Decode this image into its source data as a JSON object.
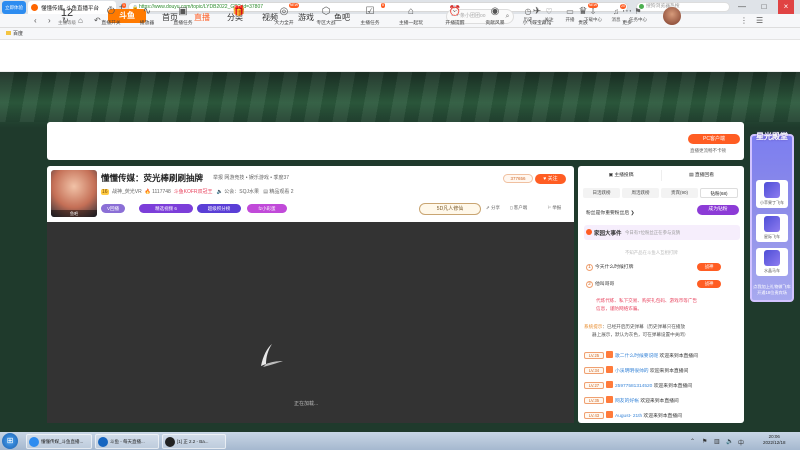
{
  "browser": {
    "logo_label": "立即体验",
    "tab_title": "懂懂传媒_斗鱼直播平台",
    "tab_close": "×",
    "new_tab": "+",
    "url": "https://www.douyu.com/topic/LYDB2022_GD?rid=37807",
    "search_placeholder": "搜狗浏览器热搜",
    "bookmark": "百度",
    "win_min": "—",
    "win_max": "□",
    "win_close": "×"
  },
  "header": {
    "logo": "斗鱼",
    "nav": [
      "首页",
      "直播",
      "分类",
      "视频",
      "游戏",
      "鱼吧"
    ],
    "search_placeholder": "一条小团团oo",
    "icons": [
      {
        "label": "历史",
        "icon": "history-icon",
        "glyph": "◷"
      },
      {
        "label": "关注",
        "icon": "heart-icon",
        "glyph": "♡"
      },
      {
        "label": "开播",
        "icon": "camera-icon",
        "glyph": "▭"
      },
      {
        "label": "下载中心",
        "icon": "download-icon",
        "glyph": "⇩"
      },
      {
        "label": "消息",
        "icon": "bell-icon",
        "glyph": "♫",
        "badge": "20"
      },
      {
        "label": "任务中心",
        "icon": "task-icon",
        "glyph": "⚑"
      }
    ]
  },
  "toolbar": {
    "level": "12",
    "level_label": "主播等级",
    "items": [
      {
        "label": "直播开关",
        "glyph": "⏻",
        "badge": "1"
      },
      {
        "label": "播放器",
        "glyph": "∿"
      },
      {
        "label": "直播任务",
        "glyph": "▣"
      },
      {
        "label": "",
        "glyph": "🎁"
      },
      {
        "label": "大力全开",
        "glyph": "◎",
        "badge": "NEW"
      },
      {
        "label": "专区大战",
        "glyph": "⬡"
      },
      {
        "label": "主播任务",
        "glyph": "☑",
        "badge": "8"
      },
      {
        "label": "主播一起玩",
        "glyph": "⌂"
      },
      {
        "label": "开播提醒",
        "glyph": "⏰"
      },
      {
        "label": "贡献风暴",
        "glyph": "◉"
      },
      {
        "label": "小飞碟宝藏馆",
        "glyph": "✈"
      },
      {
        "label": "贵族",
        "glyph": "♛",
        "badge": "NEW"
      },
      {
        "label": "更多",
        "glyph": "⋯"
      }
    ],
    "pc_button": "PC客户端",
    "pc_sub": "直播更流畅不卡顿"
  },
  "room": {
    "avatar_label": "鱼吧",
    "title": "懂懂传媒：荧光棒刷刷抽牌",
    "subtitle": "举报  网游竞技 • 娱乐游戏 • 季度37",
    "streamer": "战神_荧光VR",
    "level": "16",
    "hot": "1117748",
    "tag": "斗鱼KOFR双冠王",
    "notice": "公会：SQJ水果",
    "replay": "精品观看 2",
    "pills": [
      {
        "label": "V回播",
        "color": "#8b6fd6"
      },
      {
        "label": "精选视频  6",
        "color": "#7c3ed9"
      },
      {
        "label": "超级积分榜",
        "color": "#5a3ed6"
      },
      {
        "label": "fz小彩蛋",
        "color": "#c14ad9"
      }
    ],
    "fans": "377656",
    "follow": "关注",
    "brand": "5D凡人修仙",
    "actions": [
      "分享",
      "客户端",
      "举报"
    ],
    "loading": "正在加载..."
  },
  "chat": {
    "tabs": [
      "主播投稿",
      "直播回看"
    ],
    "rank_tabs": [
      "日活跃榜",
      "周活跃榜",
      "贵宾(90)",
      "钻粉(68)"
    ],
    "line": "粉丝是你重要粉丝后 ❯",
    "cbtn": "成为钻粉",
    "event_title": "家园大事件",
    "event_sub": "今日有7位粉丝正在参与竞猜",
    "warn": "不知产品在斗鱼人互相打牌",
    "ranks": [
      {
        "num": "1",
        "text": "今天什么时候打牌",
        "btn": "战神"
      },
      {
        "num": "2",
        "text": "他叫哥哥",
        "btn": "战神"
      }
    ],
    "notice_lines": [
      "代炼代练、私下交易、购买礼包码、游戏币等广告",
      "信息，谨防网络诈骗。"
    ],
    "sys_label": "系统提示",
    "sys_text": "：已经开启历史弹幕（历史弹幕只在播放",
    "sys_text2": "器上展示，默认为灰色，可在弹幕设置中关闭）",
    "messages": [
      {
        "lv": "LV.25",
        "user": "歌二什么时候要说呢",
        "text": " 欢迎来到本直播间"
      },
      {
        "lv": "LV.34",
        "user": "小溪明明很帅的",
        "text": " 欢迎来到本直播间"
      },
      {
        "lv": "LV.27",
        "user": "25977581314520",
        "text": " 欢迎来到本直播间"
      },
      {
        "lv": "LV.35",
        "user": "网友的好帐",
        "text": " 欢迎来到本直播间"
      },
      {
        "lv": "LV.43",
        "user": "August- 21th",
        "text": " 欢迎来到本直播间"
      }
    ]
  },
  "side_ad": {
    "title": "星光殿堂",
    "cards": [
      "小苹果丁飞车",
      "星际飞车",
      "水晶马车"
    ],
    "foot": "点我加上礼物做飞车开通18位贵宾场"
  },
  "taskbar": {
    "tasks": [
      "懂懂传媒_斗鱼直播...",
      "斗鱼 - 每天直播...",
      "[1] 正 2.2 - Ba..."
    ],
    "time": "20:06",
    "date": "2022/12/18"
  }
}
